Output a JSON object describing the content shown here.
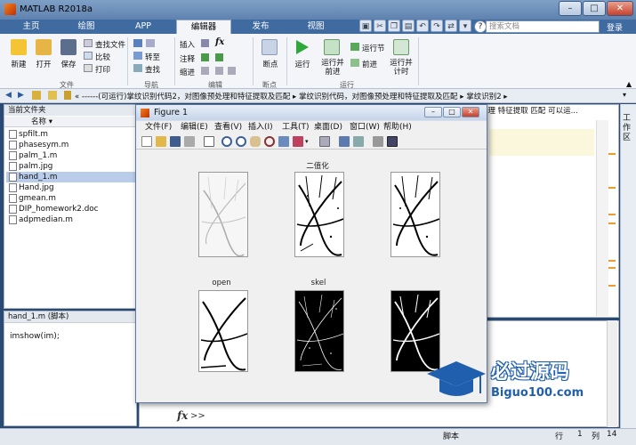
{
  "window": {
    "title": "MATLAB R2018a",
    "min": "–",
    "max": "□",
    "close": "✕"
  },
  "tabs": [
    {
      "label": "主页"
    },
    {
      "label": "绘图"
    },
    {
      "label": "APP"
    },
    {
      "label": "编辑器"
    },
    {
      "label": "发布"
    },
    {
      "label": "视图"
    }
  ],
  "search": {
    "placeholder": "搜索文档"
  },
  "user": {
    "label": "登录"
  },
  "ribbon": {
    "file": {
      "new": "新建",
      "open": "打开",
      "save": "保存",
      "find_files": "查找文件",
      "compare": "比较",
      "print": "打印",
      "section": "文件"
    },
    "nav": {
      "goto": "转至",
      "find": "查找",
      "section": "导航"
    },
    "edit": {
      "insert": "插入",
      "fx": "fx",
      "comment": "注释",
      "indent": "缩进",
      "section": "编辑"
    },
    "breakpoints": {
      "label": "断点",
      "section": "断点"
    },
    "run": {
      "run": "运行",
      "run_advance": "运行并前进",
      "run_section": "运行节",
      "advance": "前进",
      "run_time": "运行并计时",
      "section": "运行"
    }
  },
  "address": {
    "path": "« ------(可运行)掌纹识别代码2，对图像预处理和特征提取及匹配 ▸ 掌纹识别代码，对图像预处理和特征提取及匹配 ▸ 掌纹识别2 ▸"
  },
  "left_panel": {
    "title": "当前文件夹",
    "column": "名称 ▾",
    "files": [
      {
        "name": "spfilt.m",
        "selected": false
      },
      {
        "name": "phasesym.m",
        "selected": false
      },
      {
        "name": "palm_1.m",
        "selected": false
      },
      {
        "name": "palm.jpg",
        "selected": false
      },
      {
        "name": "hand_1.m",
        "selected": true
      },
      {
        "name": "Hand.jpg",
        "selected": false
      },
      {
        "name": "gmean.m",
        "selected": false
      },
      {
        "name": "DIP_homework2.doc",
        "selected": false
      },
      {
        "name": "adpmedian.m",
        "selected": false
      }
    ]
  },
  "detail": {
    "title": "hand_1.m  (脚本)",
    "code": "imshow(im);"
  },
  "editor": {
    "tab_text": "处理 特征提取 匹配 可以运..."
  },
  "right_strip": {
    "label": "工作区"
  },
  "command": {
    "fx": "fx",
    "prompt": ">>"
  },
  "status": {
    "mode": "脚本",
    "row_label": "行",
    "row": "1",
    "col_label": "列",
    "col": "14"
  },
  "figure": {
    "title": "Figure 1",
    "menu": [
      "文件(F)",
      "编辑(E)",
      "查看(V)",
      "插入(I)",
      "工具(T)",
      "桌面(D)",
      "窗口(W)",
      "帮助(H)"
    ],
    "subplot_titles": [
      "",
      "二值化",
      "",
      "open",
      "skel",
      ""
    ]
  },
  "watermark": {
    "cn": "必过源码",
    "url": "Biguo100.com"
  }
}
